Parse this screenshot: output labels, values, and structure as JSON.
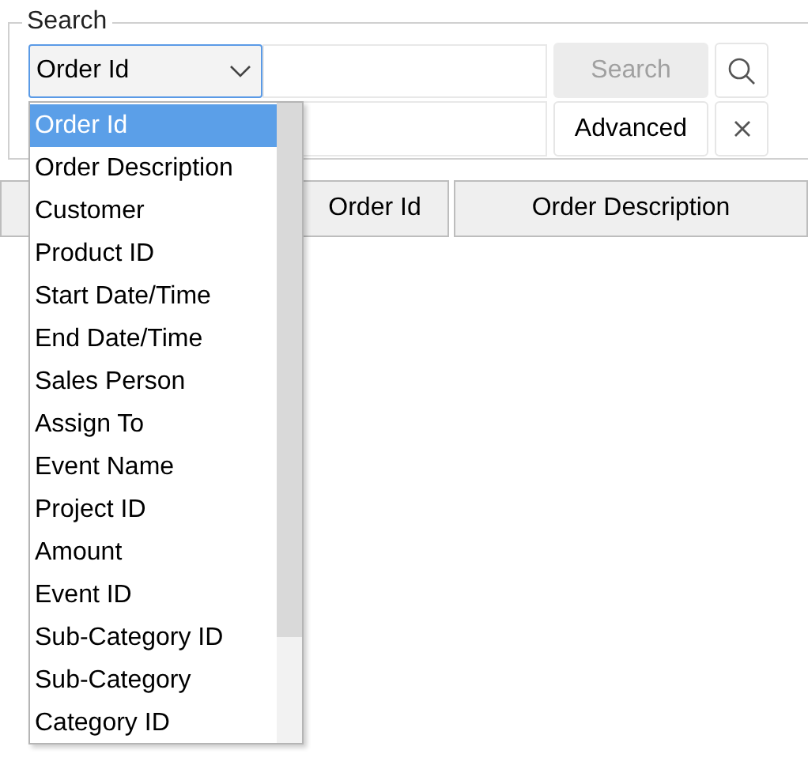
{
  "search_group": {
    "title": "Search",
    "field_select": {
      "value": "Order Id",
      "expanded": true
    },
    "search_button": {
      "label": "Search",
      "disabled": true
    },
    "advanced_button": {
      "label": "Advanced",
      "disabled": false
    }
  },
  "dropdown": {
    "items": [
      {
        "label": "Order Id",
        "selected": true
      },
      {
        "label": "Order Description",
        "selected": false
      },
      {
        "label": "Customer",
        "selected": false
      },
      {
        "label": "Product ID",
        "selected": false
      },
      {
        "label": "Start Date/Time",
        "selected": false
      },
      {
        "label": "End Date/Time",
        "selected": false
      },
      {
        "label": "Sales Person",
        "selected": false
      },
      {
        "label": "Assign To",
        "selected": false
      },
      {
        "label": "Event Name",
        "selected": false
      },
      {
        "label": "Project ID",
        "selected": false
      },
      {
        "label": "Amount",
        "selected": false
      },
      {
        "label": "Event ID",
        "selected": false
      },
      {
        "label": "Sub-Category ID",
        "selected": false
      },
      {
        "label": "Sub-Category",
        "selected": false
      },
      {
        "label": "Category ID",
        "selected": false
      }
    ]
  },
  "table": {
    "columns": [
      "Order Id",
      "Order Description"
    ]
  }
}
